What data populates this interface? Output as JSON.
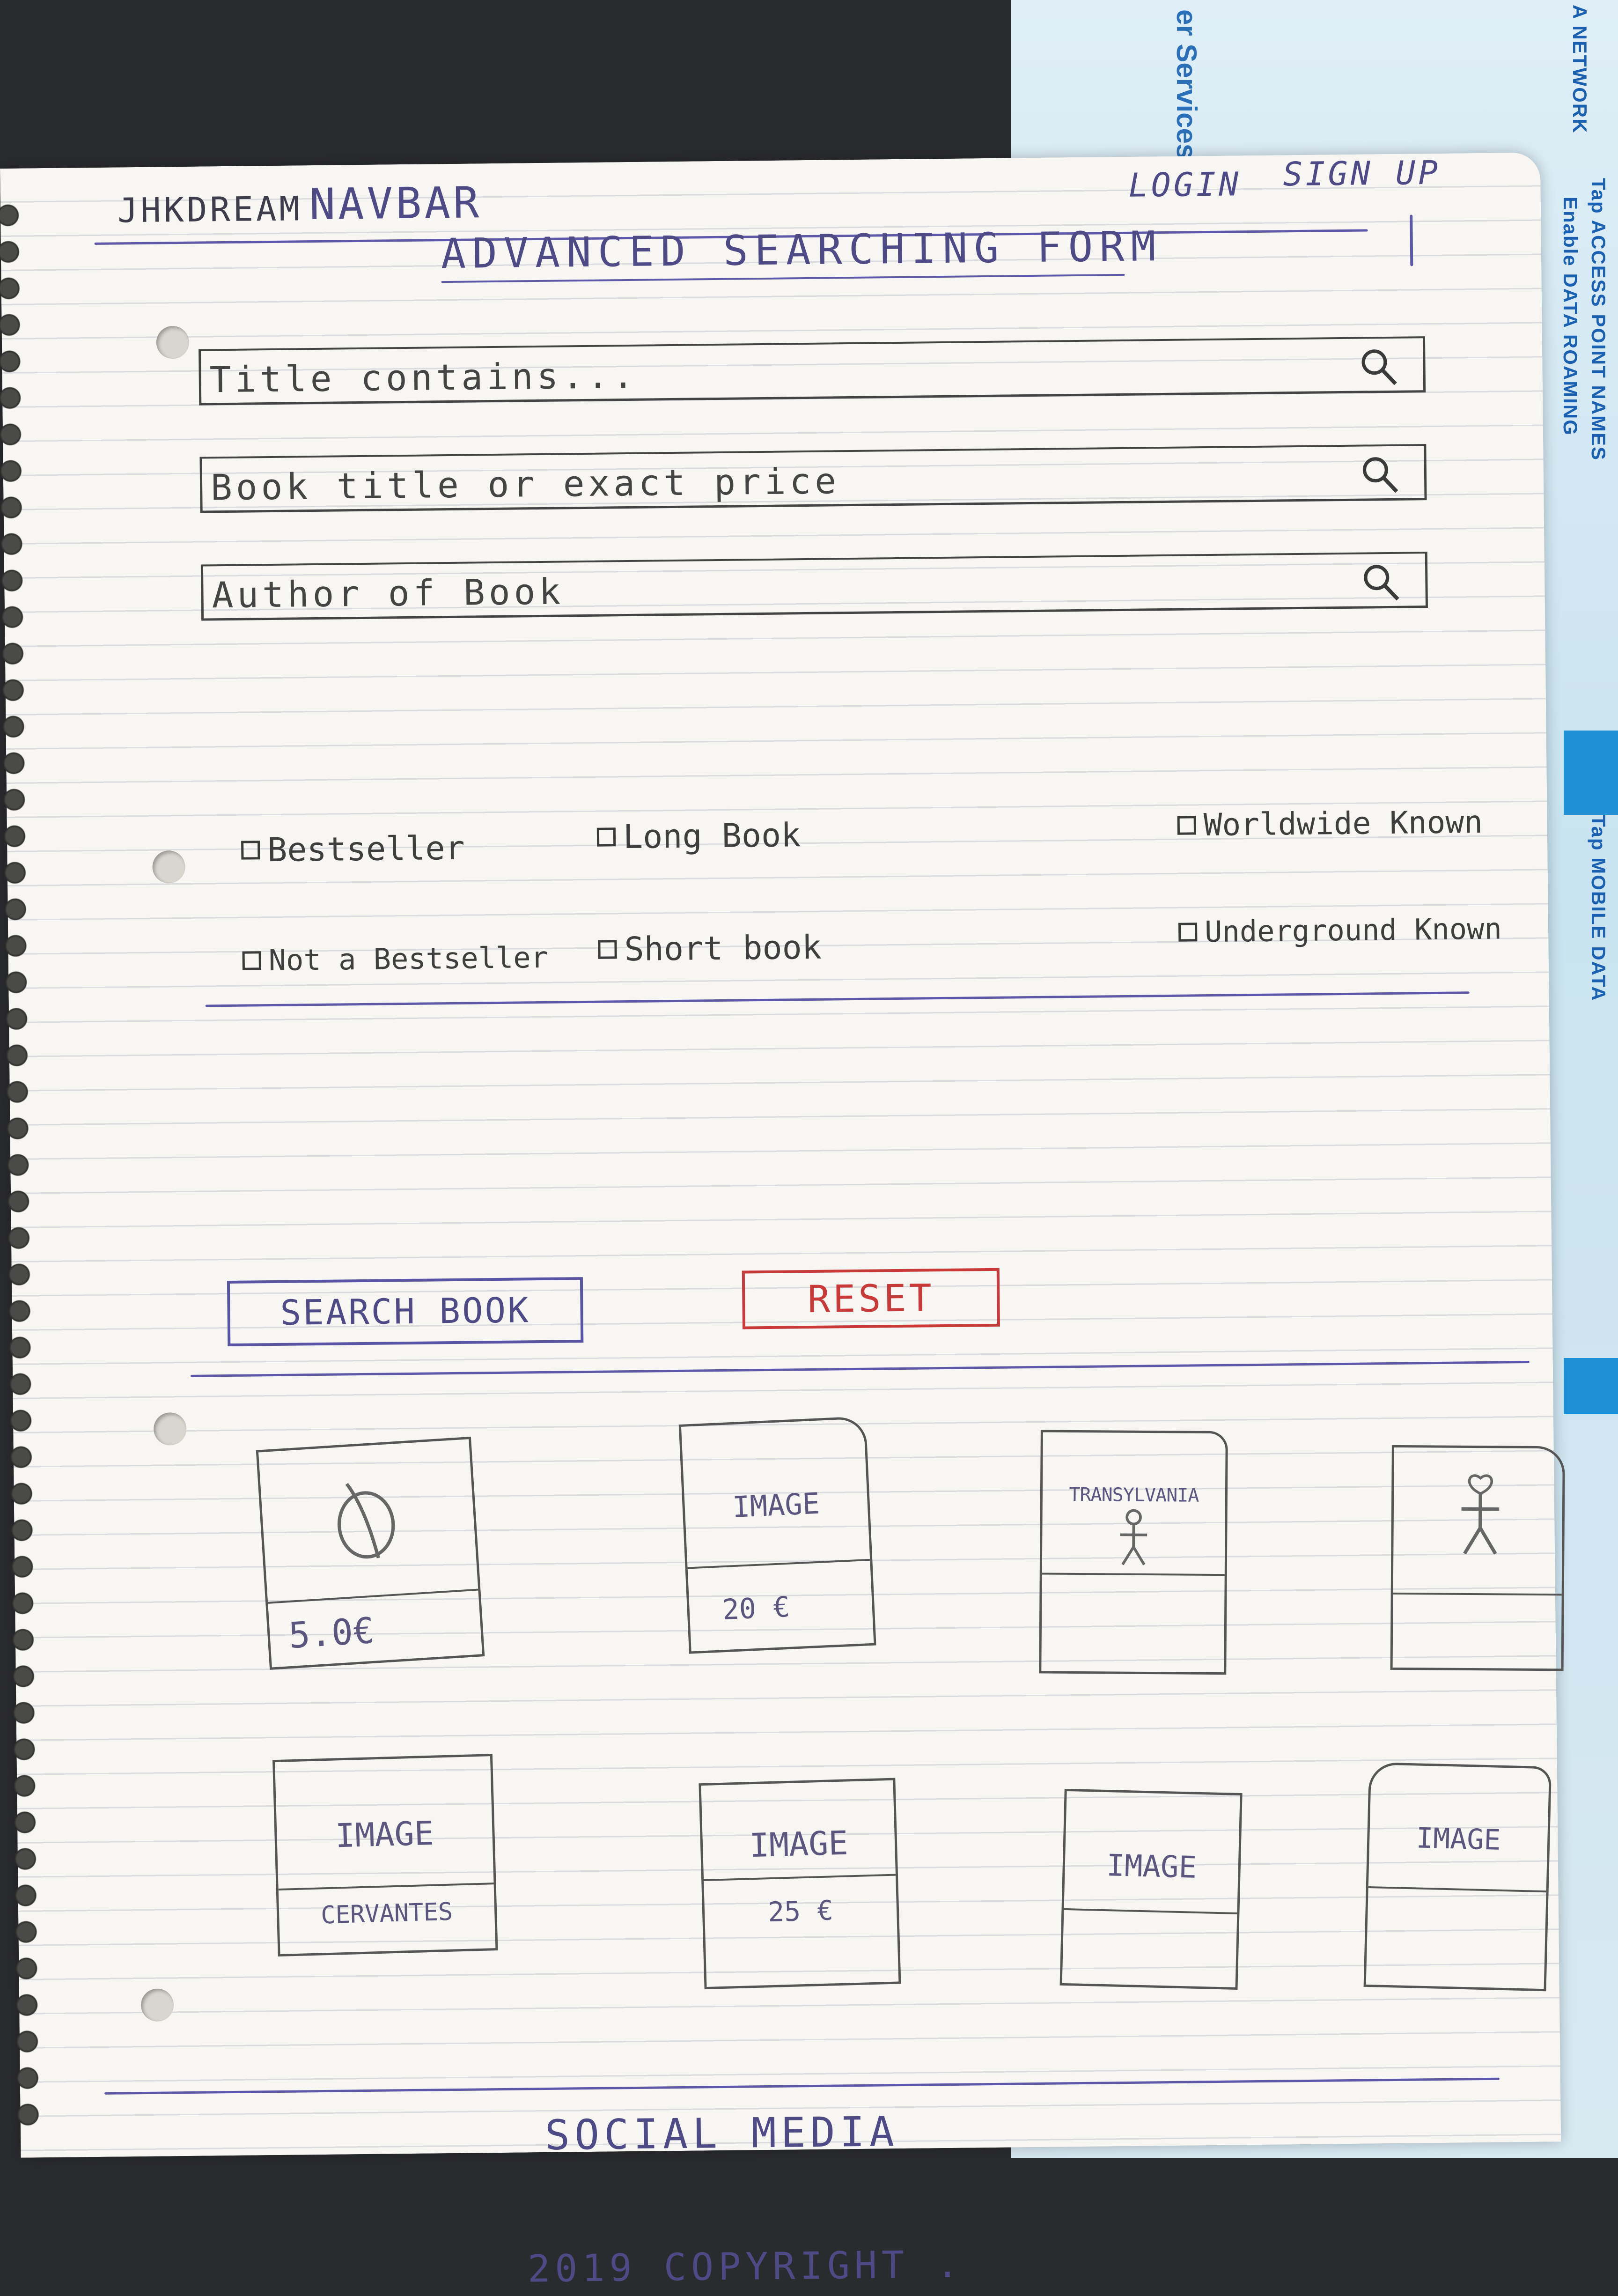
{
  "navbar": {
    "brand": "JHKDREAM",
    "title": "NAVBAR",
    "login": "LOGIN",
    "signup": "SIGN UP"
  },
  "form": {
    "heading": "ADVANCED SEARCHING FORM",
    "fields": [
      {
        "placeholder": "Title contains..."
      },
      {
        "placeholder": "Book title or exact price"
      },
      {
        "placeholder": "Author of Book"
      }
    ],
    "checkboxes": [
      "Bestseller",
      "Long Book",
      "Worldwide Known",
      "Not a Bestseller",
      "Short book",
      "Underground Known"
    ],
    "search_button": "SEARCH BOOK",
    "reset_button": "RESET"
  },
  "books": [
    {
      "image_text": "",
      "icon": "circle-sketch-icon",
      "caption": "5.0€"
    },
    {
      "image_text": "IMAGE",
      "icon": "",
      "caption": "20 €"
    },
    {
      "image_text": "TRANSYLVANIA",
      "icon": "stick-figure-icon",
      "caption": ""
    },
    {
      "image_text": "",
      "icon": "stick-figure-icon",
      "caption": ""
    },
    {
      "image_text": "IMAGE",
      "icon": "",
      "caption": "CERVANTES"
    },
    {
      "image_text": "IMAGE",
      "icon": "",
      "caption": "25 €"
    },
    {
      "image_text": "IMAGE",
      "icon": "",
      "caption": ""
    },
    {
      "image_text": "IMAGE",
      "icon": "",
      "caption": ""
    }
  ],
  "footer": {
    "social": "SOCIAL MEDIA",
    "copyright": "2019 COPYRIGHT ."
  },
  "background": {
    "doc_text_1": "er Services",
    "doc_text_2": "A NETWORK",
    "doc_text_3": "Tap ACCESS POINT NAMES",
    "doc_text_4": "Enable DATA ROAMING",
    "doc_text_5": "Tap MOBILE DATA"
  },
  "colors": {
    "ink_blue": "#4e4a86",
    "ink_red": "#c83a3a",
    "pencil": "#444444",
    "paper": "#f7f6f3"
  }
}
